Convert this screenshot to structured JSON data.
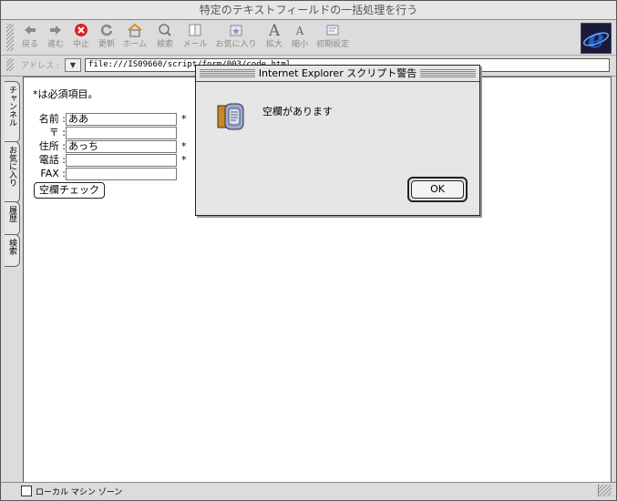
{
  "window": {
    "title": "特定のテキストフィールドの一括処理を行う"
  },
  "toolbar": {
    "buttons": [
      {
        "label": "戻る",
        "icon": "back-arrow-icon"
      },
      {
        "label": "進む",
        "icon": "forward-arrow-icon"
      },
      {
        "label": "中止",
        "icon": "stop-icon"
      },
      {
        "label": "更新",
        "icon": "refresh-icon"
      },
      {
        "label": "ホーム",
        "icon": "home-icon"
      },
      {
        "label": "検索",
        "icon": "search-icon"
      },
      {
        "label": "メール",
        "icon": "mail-icon"
      },
      {
        "label": "お気に入り",
        "icon": "favorites-icon"
      },
      {
        "label": "拡大",
        "icon": "text-larger-icon"
      },
      {
        "label": "縮小",
        "icon": "text-smaller-icon"
      },
      {
        "label": "初期設定",
        "icon": "preferences-icon"
      }
    ]
  },
  "address": {
    "label": "アドレス :",
    "url": "file:///IS09660/script/form/003/code.html"
  },
  "sidetabs": [
    "チャンネル",
    "お気に入り",
    "履歴",
    "検索"
  ],
  "form": {
    "required_note": "*は必須項目。",
    "name_label": "名前 :",
    "name_value": "ああ",
    "postal_label": "〒 :",
    "postal_value": "",
    "address_label": "住所 :",
    "address_value": "あっち",
    "phone_label": "電話 :",
    "phone_value": "",
    "fax_label": "FAX :",
    "fax_value": "",
    "required_mark": "*",
    "check_button": "空欄チェック"
  },
  "status": {
    "zone": "ローカル マシン ゾーン"
  },
  "dialog": {
    "title": "Internet Explorer スクリプト警告",
    "message": "空欄があります",
    "ok": "OK"
  },
  "colors": {
    "ie_blue": "#1a64c8",
    "stop_red": "#d22",
    "home_orange": "#e08a2a"
  }
}
